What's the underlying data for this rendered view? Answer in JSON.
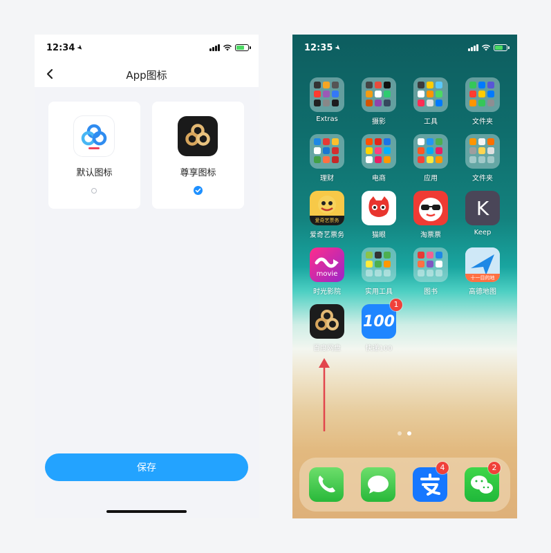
{
  "left_phone": {
    "status": {
      "time": "12:34"
    },
    "nav": {
      "title": "App图标"
    },
    "options": [
      {
        "label": "默认图标",
        "selected": false
      },
      {
        "label": "尊享图标",
        "selected": true
      }
    ],
    "save_label": "保存"
  },
  "right_phone": {
    "status": {
      "time": "12:35"
    },
    "apps": {
      "extras": "Extras",
      "photography": "摄影",
      "tools": "工具",
      "folder1": "文件夹",
      "finance": "理财",
      "ecommerce": "电商",
      "applications": "应用",
      "folder2": "文件夹",
      "iqiyi": "爱奇艺票务",
      "maoyan": "猫眼",
      "taopiaopiao": "淘票票",
      "keep": "Keep",
      "mtime": "时光影院",
      "utilities": "实用工具",
      "books": "图书",
      "amap": "高德地图",
      "baidu_netdisk": "百度网盘",
      "kuaidi100": "快递100"
    },
    "badges": {
      "kuaidi100": "1",
      "alipay": "4",
      "wechat": "2"
    },
    "iqiyi_tile_text": "爱奇艺票务",
    "mtime_tile_text": "movie",
    "amap_tile_text": "十一目的地",
    "kuaidi_tile_text": "100",
    "keep_tile_text": "K"
  }
}
